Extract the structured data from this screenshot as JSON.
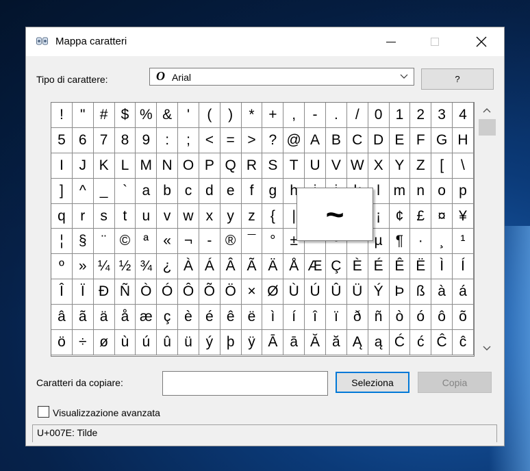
{
  "window": {
    "title": "Mappa caratteri",
    "minimize_icon": "minimize-icon",
    "maximize_icon": "maximize-icon",
    "close_icon": "close-icon"
  },
  "font": {
    "label": "Tipo di carattere:",
    "selected": "Arial",
    "type_glyph": "O",
    "help_label": "?"
  },
  "grid": {
    "characters": [
      "!",
      "\"",
      "#",
      "$",
      "%",
      "&",
      "'",
      "(",
      ")",
      "*",
      "+",
      ",",
      "-",
      ".",
      "/",
      "0",
      "1",
      "2",
      "3",
      "4",
      "5",
      "6",
      "7",
      "8",
      "9",
      ":",
      ";",
      "<",
      "=",
      ">",
      "?",
      "@",
      "A",
      "B",
      "C",
      "D",
      "E",
      "F",
      "G",
      "H",
      "I",
      "J",
      "K",
      "L",
      "M",
      "N",
      "O",
      "P",
      "Q",
      "R",
      "S",
      "T",
      "U",
      "V",
      "W",
      "X",
      "Y",
      "Z",
      "[",
      "\\",
      "]",
      "^",
      "_",
      "`",
      "a",
      "b",
      "c",
      "d",
      "e",
      "f",
      "g",
      "h",
      "i",
      "j",
      "k",
      "l",
      "m",
      "n",
      "o",
      "p",
      "q",
      "r",
      "s",
      "t",
      "u",
      "v",
      "w",
      "x",
      "y",
      "z",
      "{",
      "|",
      "}",
      "~",
      " ",
      "¡",
      "¢",
      "£",
      "¤",
      "¥",
      "¦",
      "§",
      "¨",
      "©",
      "ª",
      "«",
      "¬",
      "-",
      "®",
      "¯",
      "°",
      "±",
      "²",
      "³",
      "´",
      "µ",
      "¶",
      "·",
      "¸",
      "¹",
      "º",
      "»",
      "¼",
      "½",
      "¾",
      "¿",
      "À",
      "Á",
      "Â",
      "Ã",
      "Ä",
      "Å",
      "Æ",
      "Ç",
      "È",
      "É",
      "Ê",
      "Ë",
      "Ì",
      "Í",
      "Î",
      "Ï",
      "Ð",
      "Ñ",
      "Ò",
      "Ó",
      "Ô",
      "Õ",
      "Ö",
      "×",
      "Ø",
      "Ù",
      "Ú",
      "Û",
      "Ü",
      "Ý",
      "Þ",
      "ß",
      "à",
      "á",
      "â",
      "ã",
      "ä",
      "å",
      "æ",
      "ç",
      "è",
      "é",
      "ê",
      "ë",
      "ì",
      "í",
      "î",
      "ï",
      "ð",
      "ñ",
      "ò",
      "ó",
      "ô",
      "õ",
      "ö",
      "÷",
      "ø",
      "ù",
      "ú",
      "û",
      "ü",
      "ý",
      "þ",
      "ÿ",
      "Ā",
      "ā",
      "Ă",
      "ă",
      "Ą",
      "ą",
      "Ć",
      "ć",
      "Ĉ",
      "ĉ"
    ],
    "magnified_char": "~",
    "scroll_up_icon": "chevron-up-icon",
    "scroll_down_icon": "chevron-down-icon"
  },
  "copy": {
    "label": "Caratteri da copiare:",
    "value": "",
    "select_label": "Seleziona",
    "copy_label": "Copia"
  },
  "advanced": {
    "label": "Visualizzazione avanzata",
    "checked": false
  },
  "status": {
    "text": "U+007E: Tilde"
  }
}
